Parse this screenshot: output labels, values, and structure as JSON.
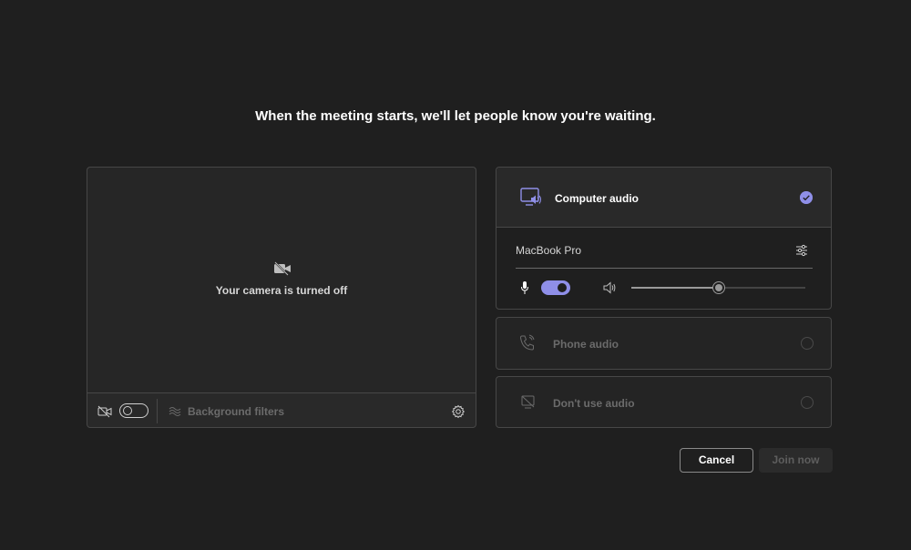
{
  "heading": "When the meeting starts, we'll let people know you're waiting.",
  "video": {
    "status_text": "Your camera is turned off",
    "camera_toggle": "off",
    "background_filters_label": "Background filters"
  },
  "audio": {
    "options": [
      {
        "label": "Computer audio",
        "icon": "computer-speaker-icon",
        "selected": true
      },
      {
        "label": "Phone audio",
        "icon": "phone-audio-icon",
        "selected": false
      },
      {
        "label": "Don't use audio",
        "icon": "no-audio-icon",
        "selected": false
      }
    ],
    "device": "MacBook Pro",
    "mic_toggle": "on",
    "volume_fraction": 0.5
  },
  "buttons": {
    "cancel": "Cancel",
    "join": "Join now"
  },
  "colors": {
    "background": "#1f1f1f",
    "accent": "#8f8fe8",
    "border": "#474747"
  }
}
